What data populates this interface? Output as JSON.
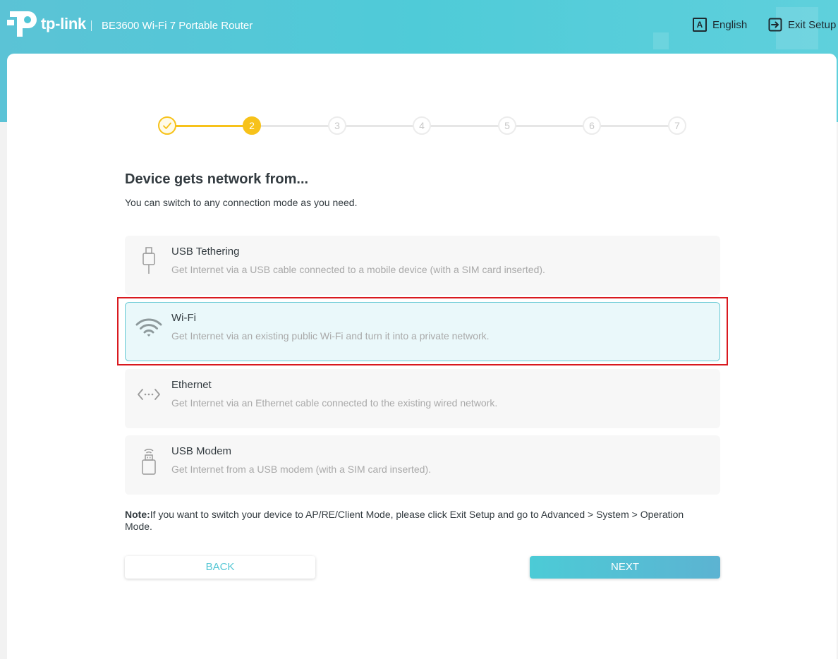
{
  "header": {
    "logo_text": "tp-link",
    "product_name": "BE3600 Wi-Fi 7 Portable Router",
    "language_label": "English",
    "language_icon_letter": "A",
    "exit_label": "Exit Setup"
  },
  "stepper": {
    "current_step": 2,
    "steps": [
      "1",
      "2",
      "3",
      "4",
      "5",
      "6",
      "7"
    ],
    "colors": {
      "done": "#f7c21a",
      "pending": "#e6e6e6"
    }
  },
  "page": {
    "title": "Device gets network from...",
    "subtitle": "You can switch to any connection mode as you need."
  },
  "options": [
    {
      "title": "USB Tethering",
      "description": "Get Internet via a USB cable connected to a mobile device (with a SIM card inserted).",
      "icon": "usb-cable-icon",
      "selected": false
    },
    {
      "title": "Wi-Fi",
      "description": "Get Internet via an existing public Wi-Fi and turn it into a private network.",
      "icon": "wifi-icon",
      "selected": true
    },
    {
      "title": "Ethernet",
      "description": "Get Internet via an Ethernet cable connected to the existing wired network.",
      "icon": "ethernet-icon",
      "selected": false
    },
    {
      "title": "USB Modem",
      "description": "Get Internet from a USB modem (with a SIM card inserted).",
      "icon": "usb-modem-icon",
      "selected": false
    }
  ],
  "note": {
    "label": "Note:",
    "text": "If you want to switch your device to AP/RE/Client Mode, please click Exit Setup and go to Advanced > System > Operation Mode."
  },
  "buttons": {
    "back": "BACK",
    "next": "NEXT"
  },
  "colors": {
    "accent": "#4fcbd8",
    "selected_border": "#66c9d4",
    "highlight": "#d9191f"
  }
}
